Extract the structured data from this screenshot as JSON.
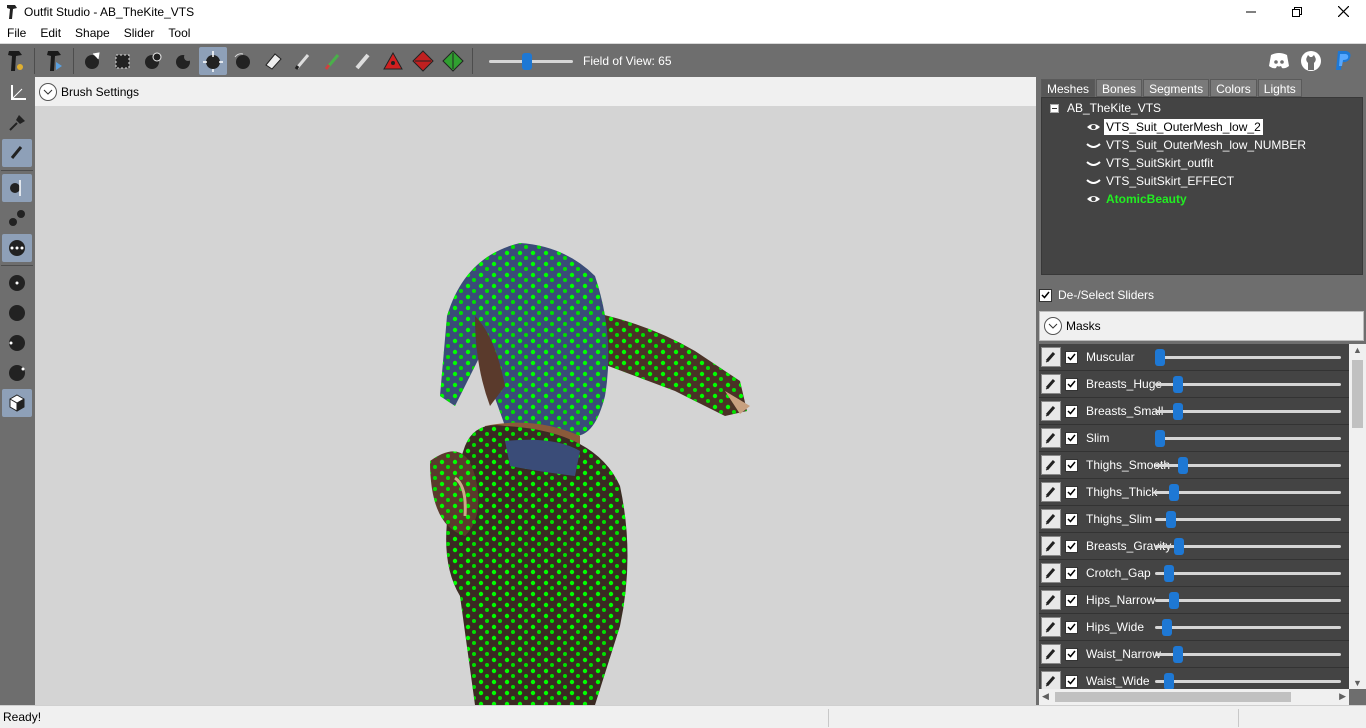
{
  "window": {
    "title": "Outfit Studio - AB_TheKite_VTS"
  },
  "menu": [
    "File",
    "Edit",
    "Shape",
    "Slider",
    "Tool"
  ],
  "toolbar": {
    "fov_label": "Field of View: 65",
    "fov_value": 65,
    "fov_fraction": 0.45,
    "tools": [
      "logo-icon",
      "copy-shapes-icon",
      "select-icon",
      "mask-icon",
      "inflate-icon",
      "deflate-icon",
      "move-icon",
      "smooth-icon",
      "undiff-icon",
      "eraser-icon",
      "color-pen-icon",
      "alpha-pen-icon",
      "brush-icon",
      "anchor-red-icon",
      "anchor-diamond-icon",
      "anchor-green-icon"
    ],
    "social": [
      "discord-icon",
      "github-icon",
      "paypal-icon"
    ],
    "colors": {
      "discord": "#5865f2",
      "github": "#ffffff",
      "paypal": "#1e78d4"
    }
  },
  "left_tools": [
    "transform-icon",
    "pin-icon",
    "pen-icon",
    "vertex-icon",
    "segments-icon",
    "dots-icon",
    "brush-small-icon",
    "brush-medium-icon",
    "brush-large-icon",
    "brush-xlarge-icon",
    "cube-icon"
  ],
  "viewport": {
    "brush_settings_label": "Brush Settings",
    "background": "#d4d4d4",
    "vertex_color": "#00ff00"
  },
  "right_panel": {
    "tabs": [
      "Meshes",
      "Bones",
      "Segments",
      "Colors",
      "Lights"
    ],
    "active_tab": "Meshes",
    "tree": {
      "root": "AB_TheKite_VTS",
      "items": [
        {
          "label": "VTS_Suit_OuterMesh_low_2",
          "visible": true,
          "selected": true
        },
        {
          "label": "VTS_Suit_OuterMesh_low_NUMBER",
          "visible": false,
          "selected": false
        },
        {
          "label": "VTS_SuitSkirt_outfit",
          "visible": false,
          "selected": false
        },
        {
          "label": "VTS_SuitSkirt_EFFECT",
          "visible": false,
          "selected": false
        },
        {
          "label": "AtomicBeauty",
          "visible": true,
          "selected": false,
          "highlight": true
        }
      ]
    },
    "deselect_label": "De-/Select Sliders",
    "masks_label": "Masks",
    "sliders": [
      {
        "name": "Muscular",
        "checked": true,
        "value": 0.0
      },
      {
        "name": "Breasts_Huge",
        "checked": true,
        "value": 0.1
      },
      {
        "name": "Breasts_Small",
        "checked": true,
        "value": 0.1
      },
      {
        "name": "Slim",
        "checked": true,
        "value": 0.0
      },
      {
        "name": "Thighs_Smooth",
        "checked": true,
        "value": 0.13
      },
      {
        "name": "Thighs_Thick",
        "checked": true,
        "value": 0.08
      },
      {
        "name": "Thighs_Slim",
        "checked": true,
        "value": 0.06
      },
      {
        "name": "Breasts_Gravity",
        "checked": true,
        "value": 0.11
      },
      {
        "name": "Crotch_Gap",
        "checked": true,
        "value": 0.05
      },
      {
        "name": "Hips_Narrow",
        "checked": true,
        "value": 0.08
      },
      {
        "name": "Hips_Wide",
        "checked": true,
        "value": 0.04
      },
      {
        "name": "Waist_Narrow",
        "checked": true,
        "value": 0.1
      },
      {
        "name": "Waist_Wide",
        "checked": true,
        "value": 0.05
      }
    ]
  },
  "status": {
    "text": "Ready!"
  }
}
